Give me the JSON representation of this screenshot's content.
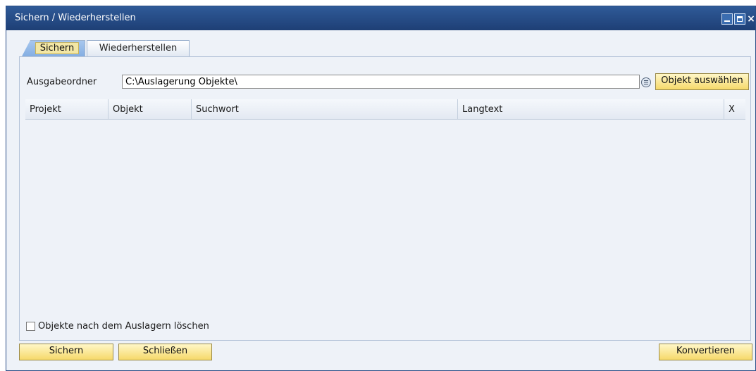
{
  "window": {
    "title": "Sichern / Wiederherstellen"
  },
  "tabs": [
    {
      "label": "Sichern",
      "active": true
    },
    {
      "label": "Wiederherstellen",
      "active": false
    }
  ],
  "output_folder": {
    "label": "Ausgabeordner",
    "value": "C:\\Auslagerung Objekte\\"
  },
  "buttons": {
    "select_object": "Objekt auswählen",
    "save": "Sichern",
    "close": "Schließen",
    "convert": "Konvertieren"
  },
  "table": {
    "columns": [
      "Projekt",
      "Objekt",
      "Suchwort",
      "Langtext",
      "X"
    ],
    "rows": []
  },
  "checkbox": {
    "label": "Objekte nach dem Auslagern löschen",
    "checked": false
  },
  "colors": {
    "title_bar": "#1e3f75",
    "button_fill": "#f6d96a",
    "active_tab": "#84aee2",
    "panel_bg": "#eef2f8"
  },
  "icons": {
    "browse": "list-icon",
    "minimize": "minimize-icon",
    "maximize": "maximize-icon",
    "close": "close-icon"
  }
}
